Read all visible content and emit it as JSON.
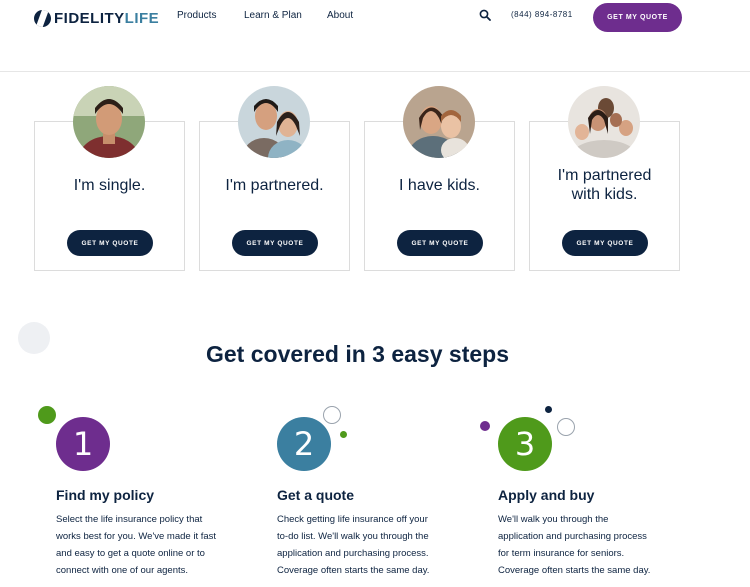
{
  "header": {
    "logo_part_1": "FIDELITY",
    "logo_part_2": "LIFE",
    "nav": [
      "Products",
      "Learn & Plan",
      "About"
    ],
    "phone": "(844) 894-8781",
    "cta_label": "GET MY QUOTE"
  },
  "personas": [
    {
      "label": "I'm single.",
      "button": "GET MY QUOTE"
    },
    {
      "label": "I'm partnered.",
      "button": "GET MY QUOTE"
    },
    {
      "label": "I have kids.",
      "button": "GET MY QUOTE"
    },
    {
      "label_line1": "I'm partnered",
      "label_line2": "with kids.",
      "button": "GET MY QUOTE"
    }
  ],
  "steps_section": {
    "title": "Get covered in 3 easy steps",
    "steps": [
      {
        "number": "1",
        "title": "Find my policy",
        "desc": [
          "Select the life insurance policy that",
          "works best for you. We've made it fast",
          "and easy to get a quote online or to",
          "connect with one of our agents."
        ]
      },
      {
        "number": "2",
        "title": "Get a quote",
        "desc": [
          "Check getting life insurance off your",
          "to-do list. We'll walk you through the",
          "application and purchasing process.",
          "Coverage often starts the same day."
        ]
      },
      {
        "number": "3",
        "title": "Apply and buy",
        "desc": [
          "We'll walk you through the",
          "application and purchasing process",
          "for term insurance for seniors.",
          "Coverage often starts the same day."
        ]
      }
    ]
  },
  "colors": {
    "navy": "#0d2340",
    "purple": "#6e2d8e",
    "teal": "#3b7fa0",
    "green": "#4f9a1b"
  }
}
